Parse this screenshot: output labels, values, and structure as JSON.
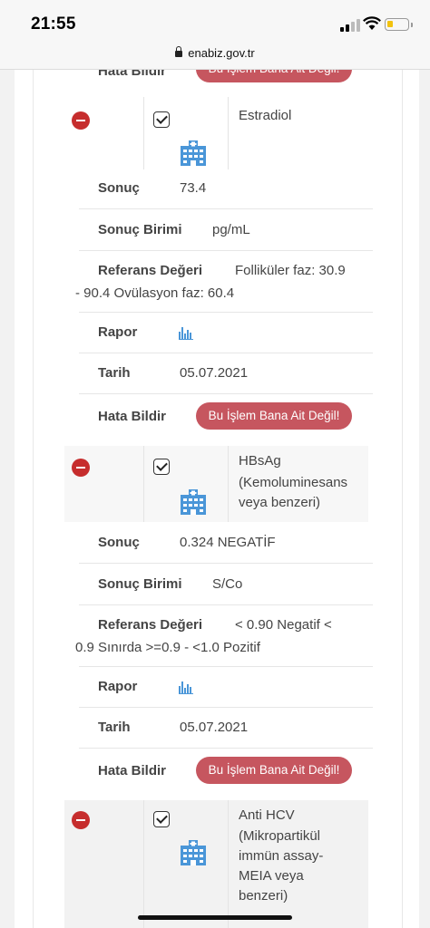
{
  "status": {
    "time": "21:55"
  },
  "browser": {
    "url": "enabiz.gov.tr"
  },
  "partial_top": {
    "label": "Hata Bildir",
    "button": "Bu İşlem Bana Ait Değil!"
  },
  "labels": {
    "result": "Sonuç",
    "unit": "Sonuç Birimi",
    "reference": "Referans Değeri",
    "report": "Rapor",
    "date": "Tarih",
    "report_error": "Hata Bildir",
    "not_mine_button": "Bu İşlem Bana Ait Değil!"
  },
  "tests": [
    {
      "name": "Estradiol",
      "result": "73.4",
      "unit": "pg/mL",
      "reference_line1": "Folliküler faz: 30.9",
      "reference_line2": "- 90.4 Ovülasyon faz: 60.4",
      "date": "05.07.2021"
    },
    {
      "name_line1": "HBsAg",
      "name_line2": "(Kemoluminesans",
      "name_line3": "veya benzeri)",
      "result": "0.324 NEGATİF",
      "unit": "S/Co",
      "reference_line1": "< 0.90 Negatif <",
      "reference_line2": "0.9 Sınırda >=0.9 - <1.0 Pozitif",
      "date": "05.07.2021"
    },
    {
      "name_line1": "Anti HCV",
      "name_line2": "(Mikropartikül",
      "name_line3": "immün assay-",
      "name_line4": "MEIA veya",
      "name_line5": "benzeri)"
    }
  ],
  "colors": {
    "remove": "#c62d2d",
    "button": "#c6565f",
    "icon": "#4a96d8"
  },
  "icons": [
    "remove-icon",
    "checkbox-icon",
    "hospital-icon",
    "bar-chart-icon",
    "lock-icon",
    "signal-icon",
    "wifi-icon",
    "battery-icon"
  ]
}
